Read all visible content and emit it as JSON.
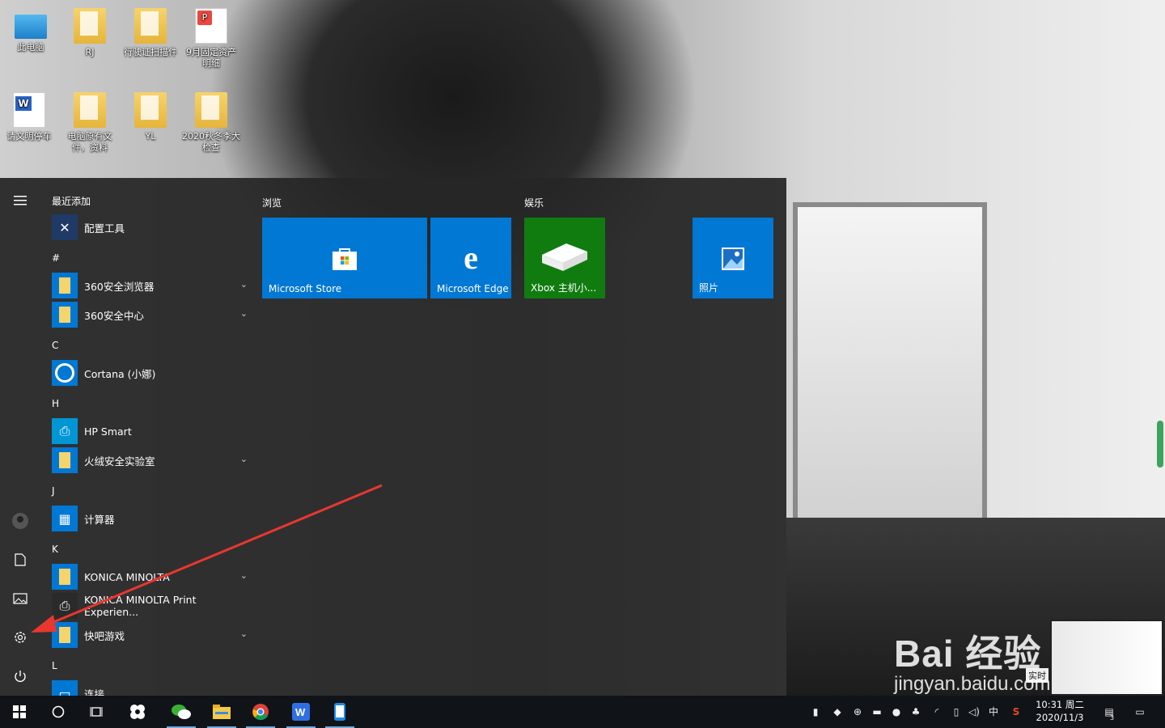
{
  "desktop": {
    "icons": [
      {
        "label": "此电脑",
        "type": "pc"
      },
      {
        "label": "RJ",
        "type": "folder"
      },
      {
        "label": "行驶证扫描件",
        "type": "folder"
      },
      {
        "label": "9月固定资产明细",
        "type": "pdf"
      },
      {
        "label": "请文明停车",
        "type": "word"
      },
      {
        "label": "电脑原有文件，资料",
        "type": "folder"
      },
      {
        "label": "YL",
        "type": "folder"
      },
      {
        "label": "2020秋冬季大检查",
        "type": "folder"
      }
    ]
  },
  "start_menu": {
    "rail": {
      "menu_icon": "hamburger-icon",
      "items": [
        "avatar",
        "documents-icon",
        "pictures-icon",
        "settings-icon",
        "power-icon"
      ]
    },
    "sections": [
      {
        "header": "最近添加",
        "apps": [
          {
            "label": "配置工具",
            "icon": "tool-icon",
            "expand": false
          }
        ]
      },
      {
        "header": "#",
        "apps": [
          {
            "label": "360安全浏览器",
            "icon": "folder-icon",
            "expand": true
          },
          {
            "label": "360安全中心",
            "icon": "folder-icon",
            "expand": true
          }
        ]
      },
      {
        "header": "C",
        "apps": [
          {
            "label": "Cortana (小娜)",
            "icon": "cortana-icon",
            "expand": false
          }
        ]
      },
      {
        "header": "H",
        "apps": [
          {
            "label": "HP Smart",
            "icon": "hp-icon",
            "expand": false
          },
          {
            "label": "火绒安全实验室",
            "icon": "folder-icon",
            "expand": true
          }
        ]
      },
      {
        "header": "J",
        "apps": [
          {
            "label": "计算器",
            "icon": "calculator-icon",
            "expand": false
          }
        ]
      },
      {
        "header": "K",
        "apps": [
          {
            "label": "KONICA MINOLTA",
            "icon": "folder-icon",
            "expand": true
          },
          {
            "label": "KONICA MINOLTA Print Experien...",
            "icon": "printer-icon",
            "expand": false
          },
          {
            "label": "快吧游戏",
            "icon": "folder-icon",
            "expand": true
          }
        ]
      },
      {
        "header": "L",
        "apps": [
          {
            "label": "连接",
            "icon": "connect-icon",
            "expand": false
          }
        ]
      }
    ],
    "tile_groups": [
      {
        "header": "浏览",
        "tiles": [
          {
            "label": "Microsoft Store",
            "color": "#0078d4",
            "icon": "store-icon"
          },
          {
            "label": "Microsoft Edge",
            "color": "#0078d4",
            "icon": "edge-icon"
          }
        ]
      },
      {
        "header": "娱乐",
        "tiles": [
          {
            "label": "Xbox 主机小...",
            "color": "#107c10",
            "icon": "xbox-icon"
          },
          {
            "label": "照片",
            "color": "#0078d4",
            "icon": "photos-icon"
          }
        ]
      }
    ]
  },
  "taskbar": {
    "buttons": [
      "start-icon",
      "search-icon",
      "task-view-icon",
      "app-icon",
      "wechat-icon",
      "file-explorer-icon",
      "chrome-icon",
      "wps-icon",
      "phone-icon"
    ],
    "tray": {
      "ime": "中",
      "time": "10:31 周二",
      "date": "2020/11/3",
      "notifications": "3"
    }
  },
  "overlay": {
    "watermark_logo": "Bai 经验",
    "watermark_url": "jingyan.baidu.com",
    "ime_label": "实时"
  }
}
